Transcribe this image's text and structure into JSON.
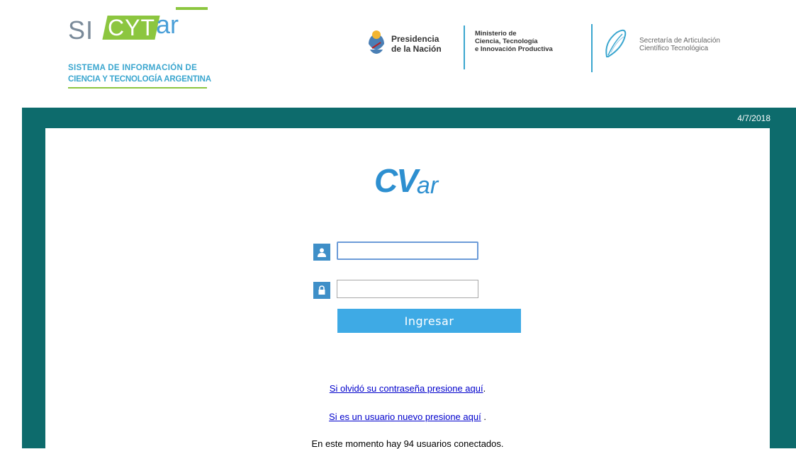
{
  "header": {
    "sicyt": {
      "si": "SI",
      "cyt": "CYT",
      "ar": "ar",
      "line1": "SISTEMA DE INFORMACIÓN DE",
      "line2": "CIENCIA Y TECNOLOGÍA ARGENTINA"
    },
    "presidencia": [
      "Presidencia",
      "de la Nación"
    ],
    "ministerio": [
      "Ministerio de",
      "Ciencia, Tecnología",
      "e Innovación Productiva"
    ],
    "secretaria": [
      "Secretaría de Articulación",
      "Científico Tecnológica"
    ]
  },
  "frame": {
    "date": "4/7/2018"
  },
  "login": {
    "logo_cv": "CV",
    "logo_ar": "ar",
    "username_value": "",
    "password_value": "",
    "user_icon": "user-icon",
    "lock_icon": "lock-icon",
    "submit_label": "Ingresar"
  },
  "links": {
    "forgot_text": "Si olvidó su contraseña presione aquí",
    "forgot_suffix": ".",
    "newuser_text": "Si es un usuario nuevo presione aquí",
    "newuser_suffix": " .",
    "online_text": "En este momento hay 94 usuarios conectados."
  },
  "colors": {
    "frame": "#0d6b6c",
    "accent_blue": "#3eaae5",
    "brand_green": "#8cc63f"
  }
}
